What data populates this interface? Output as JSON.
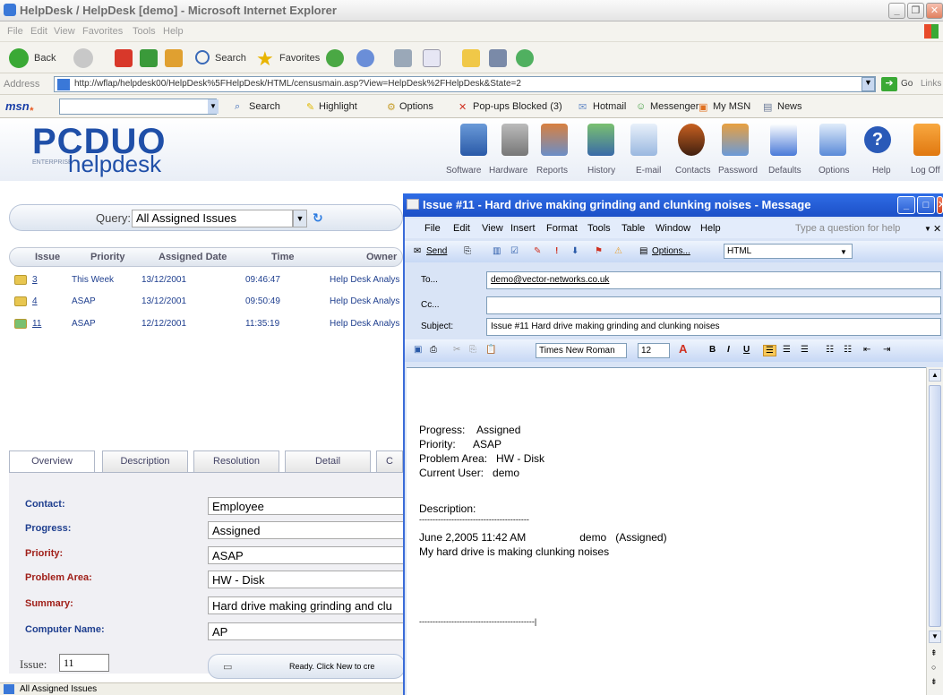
{
  "browser": {
    "title": "HelpDesk / HelpDesk [demo] - Microsoft Internet Explorer",
    "menu": [
      "File",
      "Edit",
      "View",
      "Favorites",
      "Tools",
      "Help"
    ],
    "toolbar": {
      "back": "Back",
      "search": "Search",
      "favorites": "Favorites"
    },
    "address_label": "Address",
    "address_url": "http://wflap/helpdesk00/HelpDesk%5FHelpDesk/HTML/censusmain.asp?View=HelpDesk%2FHelpDesk&State=2",
    "go_label": "Go",
    "links_label": "Links",
    "msn_bar": {
      "search": "Search",
      "highlight": "Highlight",
      "options": "Options",
      "popups": "Pop-ups Blocked (3)",
      "hotmail": "Hotmail",
      "messenger": "Messenger",
      "mymsn": "My MSN",
      "news": "News"
    },
    "status": "All Assigned Issues"
  },
  "app": {
    "logo_top": "PCDUO",
    "logo_enterprise": "ENTERPRISE",
    "logo_bottom": "helpdesk",
    "nav": [
      "Software",
      "Hardware",
      "Reports",
      "History",
      "E-mail",
      "Contacts",
      "Password",
      "Defaults",
      "Options",
      "Help",
      "Log Off"
    ],
    "query_label": "Query:",
    "query_value": "All Assigned Issues",
    "columns": [
      "Issue",
      "Priority",
      "Assigned Date",
      "Time",
      "Owner"
    ],
    "rows": [
      {
        "issue": "3",
        "priority": "This Week",
        "date": "13/12/2001",
        "time": "09:46:47",
        "owner": "Help Desk Analys"
      },
      {
        "issue": "4",
        "priority": "ASAP",
        "date": "13/12/2001",
        "time": "09:50:49",
        "owner": "Help Desk Analys"
      },
      {
        "issue": "11",
        "priority": "ASAP",
        "date": "12/12/2001",
        "time": "11:35:19",
        "owner": "Help Desk Analys"
      }
    ],
    "tabs": [
      "Overview",
      "Description",
      "Resolution",
      "Detail",
      "C"
    ],
    "fields": [
      {
        "label": "Contact:",
        "value": "Employee"
      },
      {
        "label": "Progress:",
        "value": "Assigned"
      },
      {
        "label": "Priority:",
        "value": "ASAP"
      },
      {
        "label": "Problem Area:",
        "value": "HW - Disk"
      },
      {
        "label": "Summary:",
        "value": "Hard drive making grinding and clu"
      },
      {
        "label": "Computer Name:",
        "value": "AP"
      }
    ],
    "issue_label": "Issue:",
    "issue_value": "11",
    "status_text": "Ready. Click New to cre",
    "colors": {
      "label_blue": "#1f3f8f",
      "label_red": "#a0201a"
    }
  },
  "message": {
    "title": "Issue #11 - Hard drive making grinding and clunking noises - Message",
    "menu": [
      "File",
      "Edit",
      "View",
      "Insert",
      "Format",
      "Tools",
      "Table",
      "Window",
      "Help"
    ],
    "help_placeholder": "Type a question for help",
    "tb_send": "Send",
    "tb_options": "Options...",
    "tb_format": "HTML",
    "to_label": "To...",
    "to_value": "demo@vector-networks.co.uk",
    "cc_label": "Cc...",
    "cc_value": "",
    "subject_label": "Subject:",
    "subject_value": "Issue #11   Hard drive making grinding and clunking noises",
    "font_name": "Times New Roman",
    "font_size": "12",
    "body": {
      "progress": "Progress:    Assigned",
      "priority": "Priority:      ASAP",
      "problem": "Problem Area:   HW - Disk",
      "user": "Current User:   demo",
      "desc": "Description:",
      "sep": "-----------------------------------------",
      "entry": "June 2,2005 11:42 AM                  demo   (Assigned)",
      "text": "My hard drive is making clunking noises",
      "sep2": "-------------------------------------------|"
    }
  }
}
